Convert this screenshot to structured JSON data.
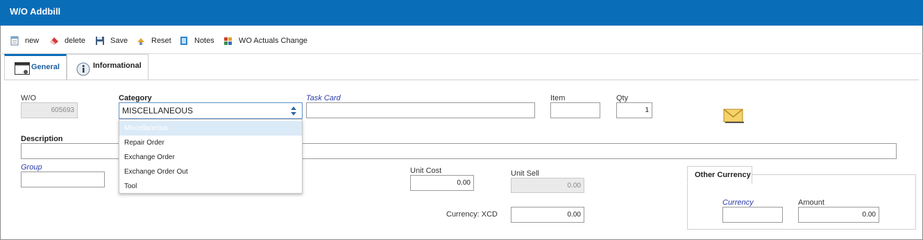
{
  "window": {
    "title": "W/O Addbill"
  },
  "toolbar": {
    "new_label": "new",
    "delete_label": "delete",
    "save_label": "Save",
    "reset_label": "Reset",
    "notes_label": "Notes",
    "actuals_label": "WO Actuals Change"
  },
  "tabs": [
    {
      "label": "General",
      "active": true
    },
    {
      "label": "Informational",
      "active": false
    }
  ],
  "form": {
    "wo_label": "W/O",
    "wo_value": "605693",
    "category_label": "Category",
    "category_value": "MISCELLANEOUS",
    "category_options": [
      "Miscellaneous",
      "Repair Order",
      "Exchange Order",
      "Exchange Order Out",
      "Tool"
    ],
    "taskcard_label": "Task Card",
    "taskcard_value": "",
    "item_label": "Item",
    "item_value": "",
    "qty_label": "Qty",
    "qty_value": "1",
    "description_label": "Description",
    "description_value": "",
    "group_label": "Group",
    "group_value": "",
    "unit_cost_label": "Unit Cost",
    "unit_cost_value": "0.00",
    "unit_sell_label": "Unit Sell",
    "unit_sell_value": "0.00",
    "currency_label": "Currency: XCD",
    "currency_amount": "0.00"
  },
  "other_currency": {
    "title": "Other Currency",
    "currency_label": "Currency",
    "currency_value": "",
    "amount_label": "Amount",
    "amount_value": "0.00"
  },
  "colors": {
    "accent": "#0a6db8",
    "link": "#2a3aa8",
    "selected_option": "#dbeaf7"
  }
}
